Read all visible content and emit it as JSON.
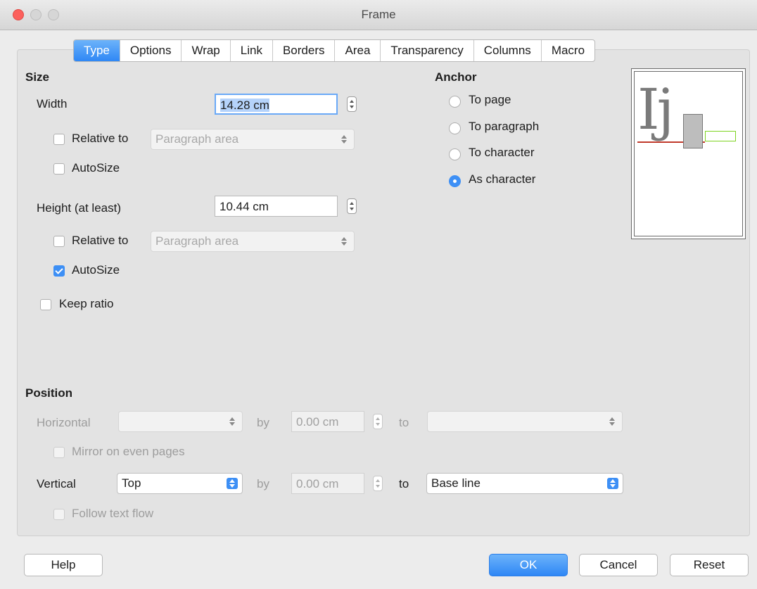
{
  "window": {
    "title": "Frame"
  },
  "tabs": [
    "Type",
    "Options",
    "Wrap",
    "Link",
    "Borders",
    "Area",
    "Transparency",
    "Columns",
    "Macro"
  ],
  "size": {
    "heading": "Size",
    "width_label": "Width",
    "width_value": "14.28 cm",
    "relative_to_label": "Relative to",
    "relative_to_value": "Paragraph area",
    "autosize_label": "AutoSize",
    "height_label": "Height (at least)",
    "height_value": "10.44 cm",
    "relative_to_label2": "Relative to",
    "relative_to_value2": "Paragraph area",
    "autosize_label2": "AutoSize",
    "keep_ratio_label": "Keep ratio"
  },
  "anchor": {
    "heading": "Anchor",
    "options": [
      "To page",
      "To paragraph",
      "To character",
      "As character"
    ],
    "selected": "As character"
  },
  "preview": {
    "glyphs": "Ij"
  },
  "position": {
    "heading": "Position",
    "horizontal_label": "Horizontal",
    "by_label": "by",
    "horizontal_by_value": "0.00 cm",
    "to_label": "to",
    "mirror_label": "Mirror on even pages",
    "vertical_label": "Vertical",
    "vertical_value": "Top",
    "vertical_by_value": "0.00 cm",
    "vertical_to_value": "Base line",
    "follow_label": "Follow text flow"
  },
  "buttons": {
    "help": "Help",
    "ok": "OK",
    "cancel": "Cancel",
    "reset": "Reset"
  },
  "colors": {
    "accent": "#3d8ff5",
    "close": "#fc605c"
  }
}
